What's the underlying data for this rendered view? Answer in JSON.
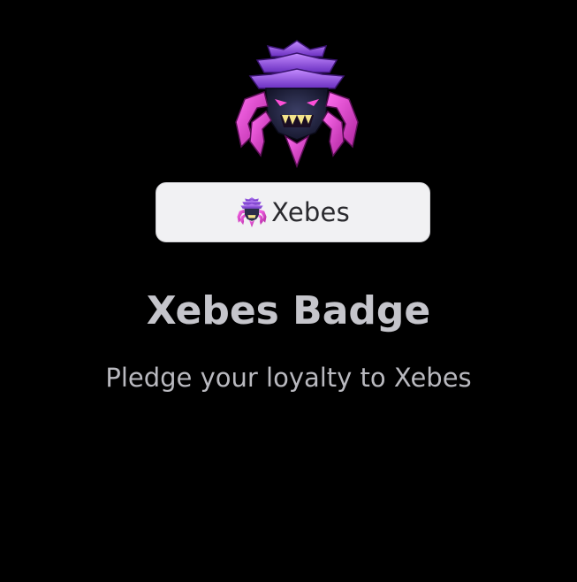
{
  "badge": {
    "emblem_icon": "xebes-emblem-icon",
    "pill_label": "Xebes",
    "title": "Xebes Badge",
    "description": "Pledge your loyalty to Xebes"
  },
  "colors": {
    "background": "#000000",
    "pill_background": "#f1f1f3",
    "title": "#c5c5cb",
    "description": "#b9b9bf",
    "emblem_purple": "#7b3fc4",
    "emblem_magenta": "#e23fd6"
  }
}
